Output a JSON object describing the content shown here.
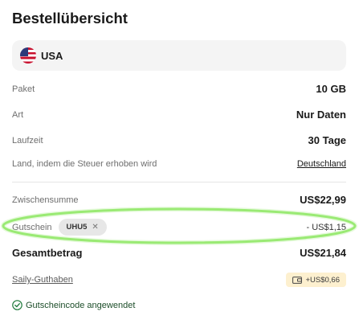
{
  "title": "Bestellübersicht",
  "country": {
    "name": "USA",
    "icon": "us-flag-icon"
  },
  "details": [
    {
      "label": "Paket",
      "value": "10 GB"
    },
    {
      "label": "Art",
      "value": "Nur Daten"
    },
    {
      "label": "Laufzeit",
      "value": "30 Tage"
    },
    {
      "label": "Land, indem die Steuer erhoben wird",
      "value": "Deutschland"
    }
  ],
  "subtotal": {
    "label": "Zwischensumme",
    "value": "US$22,99"
  },
  "coupon": {
    "label": "Gutschein",
    "code": "UHU5",
    "remove_icon": "close-icon",
    "discount": "- US$1,15"
  },
  "total": {
    "label": "Gesamtbetrag",
    "value": "US$21,84"
  },
  "credit": {
    "label": "Saily-Guthaben",
    "value": "+US$0,66",
    "icon": "wallet-icon"
  },
  "status": {
    "text": "Gutscheincode angewendet",
    "icon": "check-circle-icon",
    "color": "#1d7a3a"
  },
  "highlight_color": "#7de34f"
}
